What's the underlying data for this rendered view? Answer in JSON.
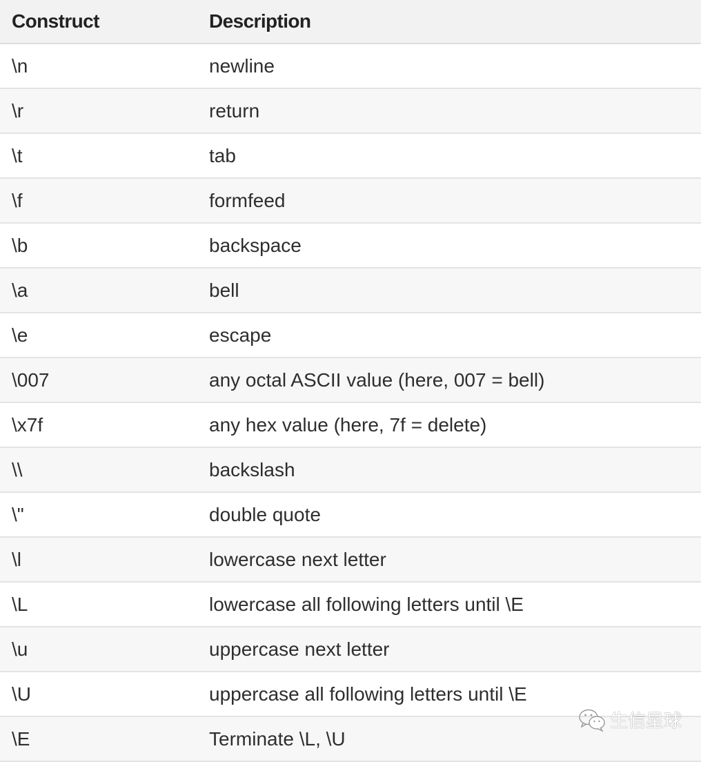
{
  "table": {
    "headers": [
      "Construct",
      "Description"
    ],
    "rows": [
      {
        "construct": "\\n",
        "description": "newline"
      },
      {
        "construct": "\\r",
        "description": "return"
      },
      {
        "construct": "\\t",
        "description": "tab"
      },
      {
        "construct": "\\f",
        "description": "formfeed"
      },
      {
        "construct": "\\b",
        "description": "backspace"
      },
      {
        "construct": "\\a",
        "description": "bell"
      },
      {
        "construct": "\\e",
        "description": "escape"
      },
      {
        "construct": "\\007",
        "description": "any octal ASCII value (here, 007 = bell)"
      },
      {
        "construct": "\\x7f",
        "description": "any hex value (here, 7f = delete)"
      },
      {
        "construct": "\\\\",
        "description": "backslash"
      },
      {
        "construct": "\\\"",
        "description": "double quote"
      },
      {
        "construct": "\\l",
        "description": "lowercase next letter"
      },
      {
        "construct": "\\L",
        "description": "lowercase all following letters until \\E"
      },
      {
        "construct": "\\u",
        "description": "uppercase next letter"
      },
      {
        "construct": "\\U",
        "description": "uppercase all following letters until \\E"
      },
      {
        "construct": "\\E",
        "description": "Terminate \\L, \\U"
      }
    ]
  },
  "watermark": {
    "icon": "wechat-icon",
    "text": "生信星球"
  }
}
